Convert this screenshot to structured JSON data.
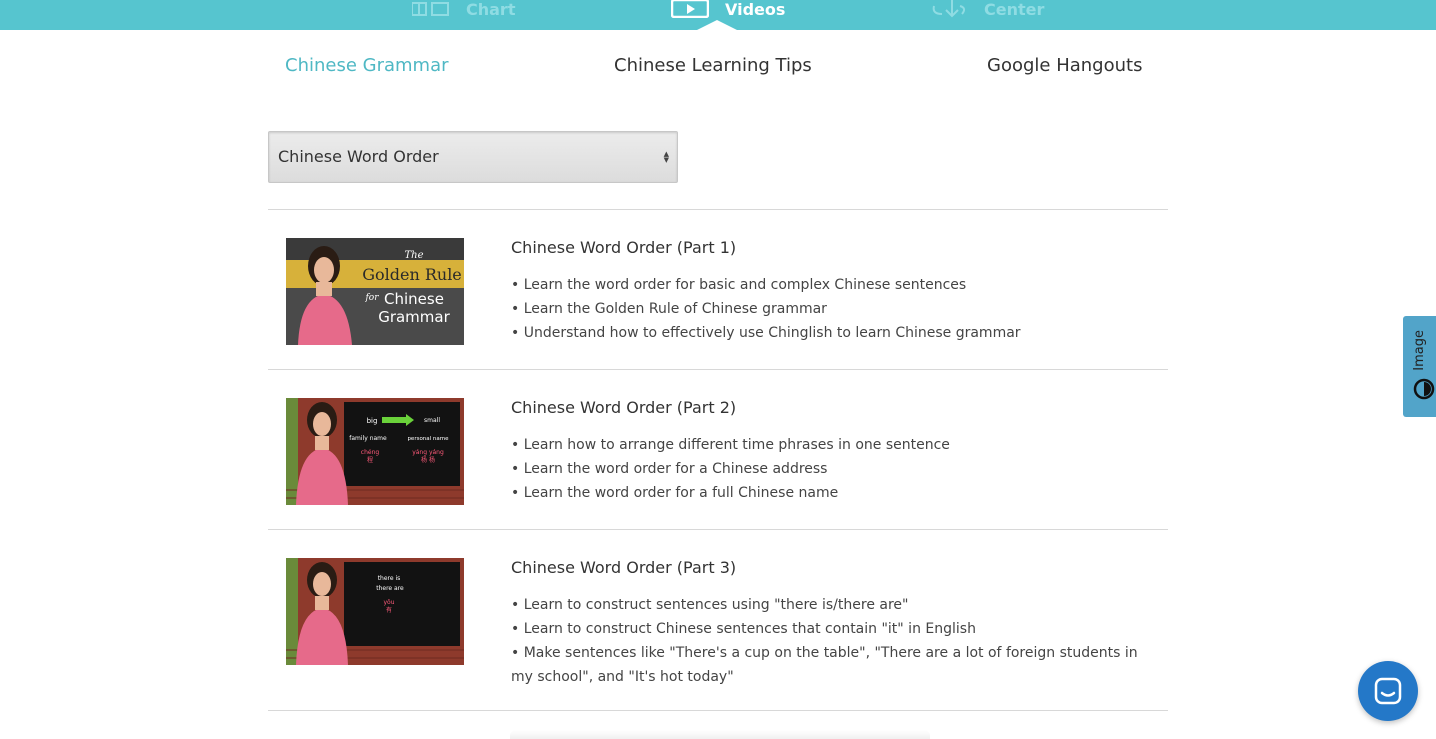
{
  "top_nav": {
    "items": [
      {
        "label": "Chart",
        "icon": "chart-icon"
      },
      {
        "label": "Videos",
        "icon": "video-icon",
        "active": true
      },
      {
        "label": "Center",
        "icon": "download-icon"
      }
    ]
  },
  "sub_nav": {
    "items": [
      {
        "label": "Chinese Grammar",
        "active": true
      },
      {
        "label": "Chinese Learning Tips"
      },
      {
        "label": "Google Hangouts"
      }
    ]
  },
  "topic_select": {
    "value": "Chinese Word Order"
  },
  "videos": [
    {
      "title": "Chinese Word Order (Part 1)",
      "thumb_text": [
        "The",
        "Golden Rule",
        "for",
        "Chinese",
        "Grammar"
      ],
      "bullets": [
        "Learn the word order for basic and complex Chinese sentences",
        "Learn the Golden Rule of Chinese grammar",
        "Understand how to effectively use Chinglish to learn Chinese grammar"
      ]
    },
    {
      "title": "Chinese Word Order (Part 2)",
      "thumb_text": [
        "big",
        "small",
        "family name",
        "personal name",
        "chéng",
        "程",
        "yáng yáng",
        "杨 杨"
      ],
      "bullets": [
        "Learn how to arrange different time phrases in one sentence",
        "Learn the word order for a Chinese address",
        "Learn the word order for a full Chinese name"
      ]
    },
    {
      "title": "Chinese Word Order (Part 3)",
      "thumb_text": [
        "there is",
        "there are",
        "yǒu",
        "有"
      ],
      "bullets": [
        "Learn to construct sentences using \"there is/there are\"",
        "Learn to construct Chinese sentences that contain \"it\" in English",
        "Make sentences like \"There's a cup on the table\", \"There are a lot of foreign students in my school\", and \"It's hot today\""
      ]
    }
  ],
  "side_tab": {
    "label": "Image"
  },
  "colors": {
    "topbar": "#56c5cf",
    "accent": "#4fb8c4",
    "side_tab": "#52a4c9",
    "chat_button": "#2478c8"
  }
}
